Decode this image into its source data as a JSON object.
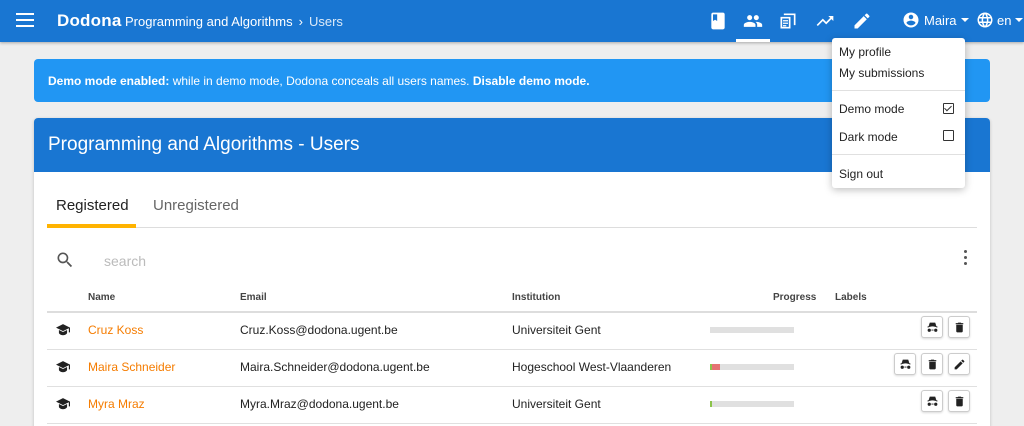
{
  "topbar": {
    "brand": "Dodona",
    "breadcrumb": {
      "course": "Programming and Algorithms",
      "current": "Users"
    },
    "icons": [
      "book-icon",
      "people-icon",
      "submissions-icon",
      "trending-icon",
      "pencil-icon"
    ],
    "user_name": "Maira",
    "language": "en"
  },
  "alert": {
    "strong_prefix": "Demo mode enabled:",
    "text": " while in demo mode, Dodona conceals all users names. ",
    "action": "Disable demo mode."
  },
  "card": {
    "title": "Programming and Algorithms - Users",
    "tabs": [
      {
        "label": "Registered",
        "active": true
      },
      {
        "label": "Unregistered",
        "active": false
      }
    ],
    "search": {
      "placeholder": "search",
      "value": ""
    },
    "columns": {
      "name": "Name",
      "email": "Email",
      "institution": "Institution",
      "progress": "Progress",
      "labels": "Labels"
    },
    "rows": [
      {
        "name": "Cruz Koss",
        "email": "Cruz.Koss@dodona.ugent.be",
        "institution": "Universiteit Gent",
        "progress_correct": 0.0,
        "progress_wrong": 0.0,
        "actions": [
          "impersonate",
          "delete"
        ]
      },
      {
        "name": "Maira Schneider",
        "email": "Maira.Schneider@dodona.ugent.be",
        "institution": "Hogeschool West-Vlaanderen",
        "progress_correct": 0.02,
        "progress_wrong": 0.1,
        "actions": [
          "impersonate",
          "delete",
          "edit"
        ]
      },
      {
        "name": "Myra Mraz",
        "email": "Myra.Mraz@dodona.ugent.be",
        "institution": "Universiteit Gent",
        "progress_correct": 0.01,
        "progress_wrong": 0.0,
        "actions": [
          "impersonate",
          "delete"
        ]
      }
    ]
  },
  "user_menu": {
    "items": [
      "My profile",
      "My submissions"
    ],
    "demo_mode": {
      "label": "Demo mode",
      "checked": true
    },
    "dark_mode": {
      "label": "Dark mode",
      "checked": false
    },
    "sign_out": "Sign out"
  },
  "colors": {
    "primary": "#1976d2",
    "alert": "#2196f3",
    "accent": "#ffb300",
    "name_link": "#f57c00"
  }
}
